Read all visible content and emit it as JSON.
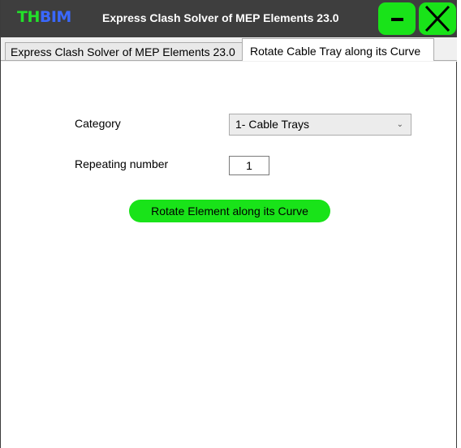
{
  "window": {
    "logo_part1": "TH",
    "logo_part2": "BIM",
    "title": "Express Clash Solver of MEP Elements 23.0"
  },
  "tabs": [
    {
      "label": "Express Clash Solver of MEP Elements 23.0",
      "active": false
    },
    {
      "label": "Rotate Cable Tray along its Curve",
      "active": true
    }
  ],
  "form": {
    "category_label": "Category",
    "category_value": "1- Cable Trays",
    "repeat_label": "Repeating number",
    "repeat_value": "1",
    "action_label": "Rotate Element along its Curve"
  },
  "colors": {
    "titlebar": "#3e3e3e",
    "accent_green": "#19e319",
    "logo_green": "#22e02a",
    "logo_blue": "#3a68ff"
  },
  "icons": {
    "minimize": "minimize-icon",
    "close": "close-icon",
    "dropdown": "chevron-down-icon"
  }
}
